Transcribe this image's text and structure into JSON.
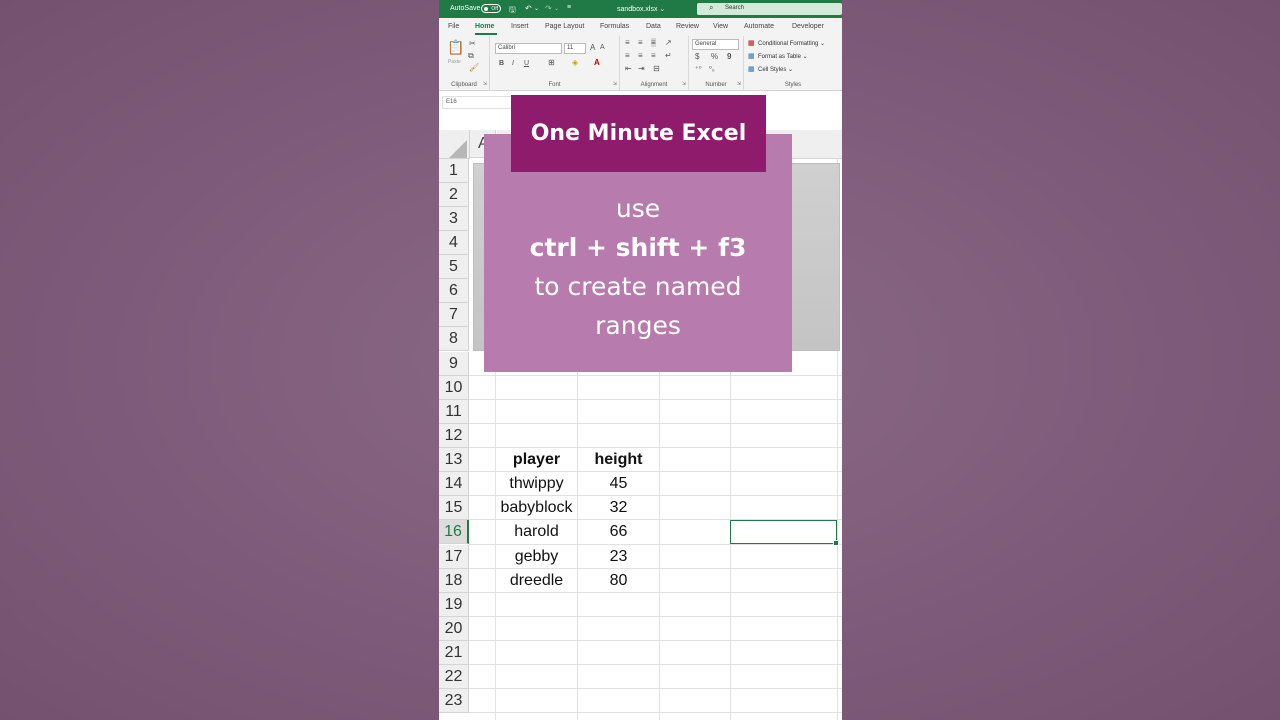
{
  "titlebar": {
    "autosave_label": "AutoSave",
    "autosave_state": "Off",
    "filename": "sandbox.xlsx ⌄",
    "search_placeholder": "Search"
  },
  "tabs": [
    "File",
    "Home",
    "Insert",
    "Page Layout",
    "Formulas",
    "Data",
    "Review",
    "View",
    "Automate",
    "Developer"
  ],
  "active_tab": "Home",
  "ribbon": {
    "clipboard": {
      "paste_label": "Paste",
      "group_label": "Clipboard"
    },
    "font": {
      "font_name": "Calibri",
      "font_size": "11",
      "group_label": "Font",
      "bold": "B",
      "italic": "I",
      "underline": "U"
    },
    "alignment": {
      "group_label": "Alignment"
    },
    "number": {
      "format": "General",
      "currency": "$",
      "percent": "%",
      "comma": "9",
      "group_label": "Number"
    },
    "styles": {
      "conditional_formatting": "Conditional Formatting ⌄",
      "format_as_table": "Format as Table ⌄",
      "cell_styles": "Cell Styles ⌄",
      "group_label": "Styles"
    }
  },
  "name_box": "E16",
  "grid": {
    "column_header_partial": "A",
    "row_numbers": [
      "1",
      "2",
      "3",
      "4",
      "5",
      "6",
      "7",
      "8",
      "9",
      "10",
      "11",
      "12",
      "13",
      "14",
      "15",
      "16",
      "17",
      "18",
      "19",
      "20",
      "21",
      "22",
      "23"
    ],
    "selected_row": "16",
    "table": {
      "headers": [
        "player",
        "height"
      ],
      "rows": [
        [
          "thwippy",
          "45"
        ],
        [
          "babyblock",
          "32"
        ],
        [
          "harold",
          "66"
        ],
        [
          "gebby",
          "23"
        ],
        [
          "dreedle",
          "80"
        ]
      ]
    }
  },
  "overlay": {
    "banner": "One Minute Excel",
    "line1": "use",
    "line2": "ctrl + shift + f3",
    "line3": "to create named",
    "line4": "ranges"
  },
  "colors": {
    "excel_green": "#1f7a45",
    "banner": "#8e1b6b",
    "card": "#b87bae",
    "background": "#7d5a79"
  }
}
